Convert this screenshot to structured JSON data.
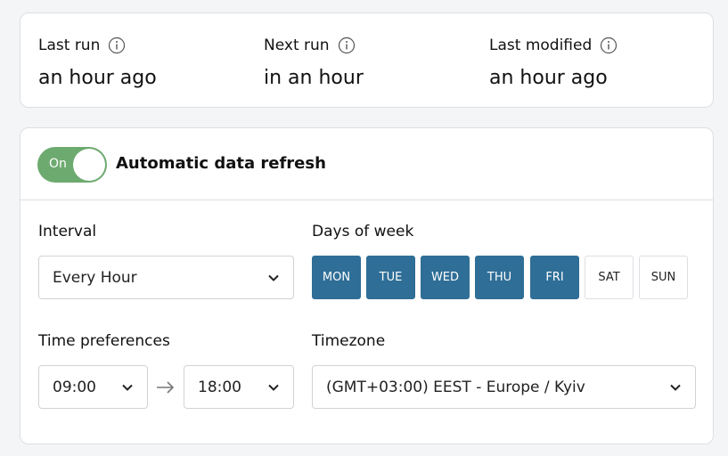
{
  "stats": {
    "last_run": {
      "label": "Last run",
      "value": "an hour ago",
      "icon": "info-icon"
    },
    "next_run": {
      "label": "Next run",
      "value": "in an hour",
      "icon": "info-icon"
    },
    "last_modified": {
      "label": "Last modified",
      "value": "an hour ago",
      "icon": "info-icon"
    }
  },
  "refresh": {
    "toggle_label": "On",
    "toggle_state": "on",
    "title": "Automatic data refresh",
    "interval": {
      "label": "Interval",
      "value": "Every Hour"
    },
    "days_of_week": {
      "label": "Days of week",
      "days": [
        {
          "label": "MON",
          "selected": true
        },
        {
          "label": "TUE",
          "selected": true
        },
        {
          "label": "WED",
          "selected": true
        },
        {
          "label": "THU",
          "selected": true
        },
        {
          "label": "FRI",
          "selected": true
        },
        {
          "label": "SAT",
          "selected": false
        },
        {
          "label": "SUN",
          "selected": false
        }
      ]
    },
    "time_preferences": {
      "label": "Time preferences",
      "start": "09:00",
      "end": "18:00"
    },
    "timezone": {
      "label": "Timezone",
      "value": "(GMT+03:00) EEST - Europe / Kyiv"
    }
  },
  "colors": {
    "toggle_on": "#6daa6f",
    "day_selected": "#2f6e96",
    "border": "#dcdfe2"
  }
}
